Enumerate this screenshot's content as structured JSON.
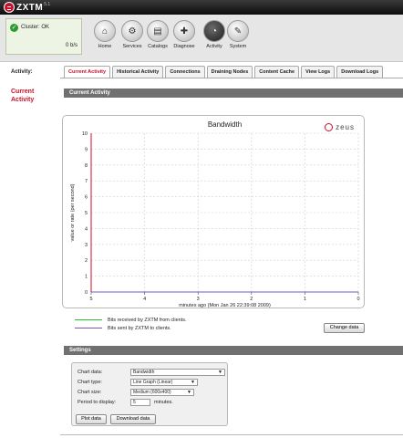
{
  "app": {
    "logo_text": "ZXTM",
    "version": "5.1"
  },
  "cluster": {
    "status": "Cluster: OK",
    "rate": "0 b/s"
  },
  "nav": [
    {
      "label": "Home",
      "icon": "home-icon",
      "glyph": "⌂"
    },
    {
      "label": "Services",
      "icon": "services-icon",
      "glyph": "⚙"
    },
    {
      "label": "Catalogs",
      "icon": "catalogs-icon",
      "glyph": "▤"
    },
    {
      "label": "Diagnose",
      "icon": "diagnose-icon",
      "glyph": "✚"
    },
    {
      "label": "Activity",
      "icon": "activity-icon",
      "glyph": "◔"
    },
    {
      "label": "System",
      "icon": "wrench-icon",
      "glyph": "✎"
    }
  ],
  "section_label": "Activity:",
  "tabs": [
    "Current Activity",
    "Historical Activity",
    "Connections",
    "Draining Nodes",
    "Content Cache",
    "View Logs",
    "Download Logs"
  ],
  "active_tab": "Current Activity",
  "side_title": "Current Activity",
  "current_activity_header": "Current Activity",
  "brand_logo": "zeus",
  "chart_data": {
    "type": "line",
    "title": "Bandwidth",
    "xlabel": "minutes ago (Mon Jan 26 22:39:08 2009)",
    "ylabel": "value or rate (per second)",
    "x_ticks": [
      "5",
      "4",
      "3",
      "2",
      "1",
      "0"
    ],
    "y_ticks": [
      "0",
      "1",
      "2",
      "3",
      "4",
      "5",
      "6",
      "7",
      "8",
      "9",
      "10"
    ],
    "xlim": [
      5,
      0
    ],
    "ylim": [
      0,
      10
    ],
    "grid": true,
    "x": [
      5,
      4,
      3,
      2,
      1,
      0
    ],
    "series": [
      {
        "name": "Bits received by ZXTM from clients.",
        "color": "#2bbf2b",
        "values": [
          0,
          0,
          0,
          0,
          0,
          0
        ]
      },
      {
        "name": "Bits sent by ZXTM to clients.",
        "color": "#7b55c0",
        "values": [
          0,
          0,
          0,
          0,
          0,
          0
        ]
      }
    ]
  },
  "change_data_label": "Change data",
  "settings": {
    "header": "Settings",
    "chart_data_label": "Chart data:",
    "chart_data_value": "Bandwidth",
    "chart_type_label": "Chart type:",
    "chart_type_value": "Line Graph (Linear)",
    "chart_size_label": "Chart size:",
    "chart_size_value": "Medium (600x400)",
    "period_label": "Period to display:",
    "period_value": "5",
    "period_unit": "minutes.",
    "plot_label": "Plot data",
    "download_label": "Download data"
  }
}
